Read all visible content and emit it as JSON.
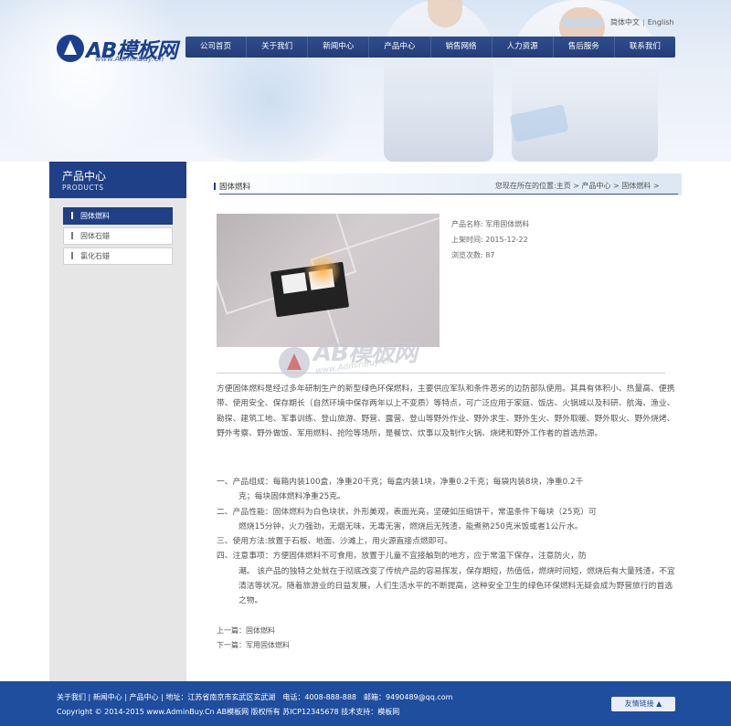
{
  "header": {
    "logo_text": "AB模板网",
    "logo_url": "www.AdminBuy.Cn",
    "lang": [
      "简体中文",
      "English"
    ]
  },
  "nav": [
    "公司首页",
    "关于我们",
    "新闻中心",
    "产品中心",
    "销售网络",
    "人力资源",
    "售后服务",
    "联系我们"
  ],
  "sidebar": {
    "title": "产品中心",
    "subtitle": "PRODUCTS",
    "items": [
      {
        "label": "固体燃料",
        "active": true
      },
      {
        "label": "固体石蜡",
        "active": false
      },
      {
        "label": "氯化石蜡",
        "active": false
      }
    ]
  },
  "content": {
    "section_title": "固体燃料",
    "breadcrumb": "您现在所在的位置:主页 > 产品中心 > 固体燃料 >",
    "product_name": "产品名称: 军用固体燃料",
    "date": "上架时间: 2015-12-22",
    "views": "浏览次数: 87",
    "watermark_text": "AB模板网",
    "watermark_url": "www.AdminBuy.Cn",
    "description": "方便固体燃料是经过多年研制生产的新型绿色环保燃料，主要供应军队和条件恶劣的边防部队使用。其具有体积小、热量高、便携带、使用安全、保存期长（自然环境中保存两年以上不变质）等特点，可广泛应用于家庭、饭店、火锅城以及科研、航海、渔业、勘探、建筑工地、军事训练、登山旅游、野营、露营、登山等野外作业、野外求生、野外生火、野外取暖、野外取火、野外烧烤、野外考察、野外做饭、军用燃料、抢险等场所，是餐饮、炊事以及制作火锅、烧烤和野外工作者的首选热源。",
    "specs": [
      {
        "first": "一、产品组成：每箱内装100盒，净重20千克；每盒内装1块，净重0.2千克；每袋内装8块，净重0.2千",
        "cont": "克；每块固体燃料净重25克。"
      },
      {
        "first": "二、产品性能：固体燃料为白色块状，外形美观，表面光亮，坚硬如压缩饼干，常温条件下每块（25克）可",
        "cont": "燃烧15分钟，火力强劲，无烟无味，无毒无害，燃烧后无残渣，能煮熟250克米饭或者1公斤水。"
      },
      {
        "first": "三、使用方法:放置于石板、地面、沙滩上，用火源直接点燃即可。",
        "cont": ""
      },
      {
        "first": "四、注意事项：方便固体燃料不可食用，放置于儿童不宜接触到的地方，应于常温下保存，注意防火，防",
        "cont": "潮。 该产品的独特之处就在于彻底改变了传统产品的容易挥发，保存期短，热值低，燃烧时间短，燃烧后有大量残渣，不宜清洁等状况。随着旅游业的日益发展，人们生活水平的不断提高，这种安全卫生的绿色环保燃料无疑会成为野营旅行的首选之物。"
      }
    ],
    "prev": "上一篇：固体燃料",
    "next": "下一篇：军用固体燃料"
  },
  "footer": {
    "links": "关于我们 | 新闻中心 | 产品中心 | 地址：江苏省南京市玄武区玄武湖　电话：4008-888-888　邮箱：9490489@qq.com",
    "copyright": "Copyright © 2014-2015 www.AdminBuy.Cn AB模板网 版权所有  苏ICP12345678 技术支持：模板网",
    "friend_links": "友情链接 ▲"
  }
}
